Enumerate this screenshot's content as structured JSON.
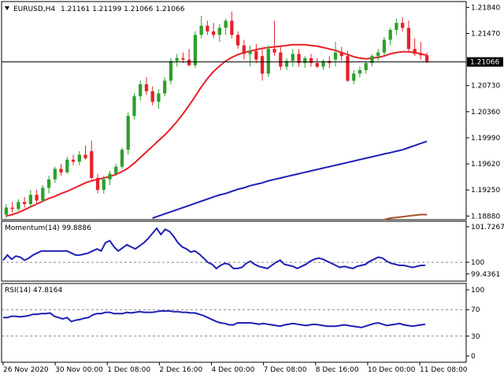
{
  "header": {
    "symbol": "EURUSD,H4",
    "ohlc": "1.21161 1.21199 1.21066 1.21066"
  },
  "colors": {
    "bull": "#2ca02c",
    "bear": "#e8202a",
    "sma_short": "#e8202a",
    "sma_long": "#1f1fb4",
    "sma_longest": "#a0522d",
    "indicator": "#1f1fb4"
  },
  "chart_data": [
    {
      "type": "candlestick",
      "title": "EURUSD,H4",
      "y_ticks": [
        "1.21840",
        "1.21470",
        "1.21066",
        "1.20730",
        "1.20360",
        "1.19990",
        "1.19620",
        "1.19250",
        "1.18880"
      ],
      "ylim": [
        1.1885,
        1.219
      ],
      "current_price": 1.21066,
      "x_ticks": [
        "26 Nov 2020",
        "30 Nov 00:00",
        "1 Dec 08:00",
        "2 Dec 16:00",
        "4 Dec 00:00",
        "7 Dec 08:00",
        "8 Dec 16:00",
        "10 Dec 00:00",
        "11 Dec 08:00"
      ],
      "candles": [
        [
          1.189,
          1.1905,
          1.1885,
          1.19
        ],
        [
          1.19,
          1.1908,
          1.1893,
          1.1898
        ],
        [
          1.1898,
          1.1912,
          1.1895,
          1.1908
        ],
        [
          1.1908,
          1.1915,
          1.19,
          1.1905
        ],
        [
          1.1905,
          1.1925,
          1.19,
          1.1918
        ],
        [
          1.1918,
          1.1925,
          1.1905,
          1.191
        ],
        [
          1.191,
          1.1932,
          1.1908,
          1.1928
        ],
        [
          1.1928,
          1.1945,
          1.192,
          1.194
        ],
        [
          1.194,
          1.1958,
          1.1935,
          1.1955
        ],
        [
          1.1955,
          1.1962,
          1.1945,
          1.195
        ],
        [
          1.195,
          1.1972,
          1.1948,
          1.1968
        ],
        [
          1.1968,
          1.1975,
          1.196,
          1.1965
        ],
        [
          1.1965,
          1.198,
          1.196,
          1.1975
        ],
        [
          1.1975,
          1.1988,
          1.1968,
          1.197
        ],
        [
          1.198,
          1.1995,
          1.194,
          1.1942
        ],
        [
          1.1942,
          1.1948,
          1.192,
          1.1925
        ],
        [
          1.1925,
          1.1945,
          1.192,
          1.194
        ],
        [
          1.194,
          1.1952,
          1.1932,
          1.1948
        ],
        [
          1.1948,
          1.1962,
          1.1945,
          1.1958
        ],
        [
          1.1958,
          1.1985,
          1.1955,
          1.1982
        ],
        [
          1.1982,
          1.2035,
          1.1975,
          1.203
        ],
        [
          1.203,
          1.2062,
          1.2025,
          1.2058
        ],
        [
          1.2058,
          1.208,
          1.2052,
          1.2075
        ],
        [
          1.2075,
          1.2085,
          1.206,
          1.2065
        ],
        [
          1.2065,
          1.2072,
          1.2045,
          1.205
        ],
        [
          1.205,
          1.2068,
          1.204,
          1.2062
        ],
        [
          1.2062,
          1.2085,
          1.2058,
          1.208
        ],
        [
          1.208,
          1.2112,
          1.2075,
          1.2108
        ],
        [
          1.2108,
          1.2118,
          1.21,
          1.2112
        ],
        [
          1.2112,
          1.212,
          1.2105,
          1.211
        ],
        [
          1.211,
          1.2125,
          1.21,
          1.2102
        ],
        [
          1.2102,
          1.215,
          1.2098,
          1.2145
        ],
        [
          1.2145,
          1.2172,
          1.214,
          1.2158
        ],
        [
          1.2158,
          1.2165,
          1.2145,
          1.215
        ],
        [
          1.215,
          1.2162,
          1.214,
          1.2145
        ],
        [
          1.2145,
          1.216,
          1.2135,
          1.2155
        ],
        [
          1.2155,
          1.2168,
          1.2145,
          1.2165
        ],
        [
          1.2165,
          1.2178,
          1.214,
          1.2145
        ],
        [
          1.2145,
          1.215,
          1.2125,
          1.213
        ],
        [
          1.213,
          1.2138,
          1.211,
          1.2118
        ],
        [
          1.2118,
          1.213,
          1.21,
          1.2122
        ],
        [
          1.2122,
          1.2132,
          1.2105,
          1.211
        ],
        [
          1.2115,
          1.2125,
          1.208,
          1.209
        ],
        [
          1.209,
          1.213,
          1.2085,
          1.2125
        ],
        [
          1.2125,
          1.2165,
          1.2115,
          1.212
        ],
        [
          1.212,
          1.2128,
          1.2095,
          1.21
        ],
        [
          1.21,
          1.2112,
          1.2095,
          1.2108
        ],
        [
          1.2108,
          1.2125,
          1.21,
          1.2118
        ],
        [
          1.2118,
          1.2125,
          1.21,
          1.2105
        ],
        [
          1.2105,
          1.2115,
          1.2098,
          1.2112
        ],
        [
          1.2112,
          1.2118,
          1.21,
          1.2105
        ],
        [
          1.2105,
          1.2112,
          1.2098,
          1.21
        ],
        [
          1.21,
          1.211,
          1.2095,
          1.2108
        ],
        [
          1.2108,
          1.2115,
          1.2098,
          1.2105
        ],
        [
          1.211,
          1.2135,
          1.21,
          1.212
        ],
        [
          1.212,
          1.2128,
          1.2108,
          1.2115
        ],
        [
          1.2115,
          1.2122,
          1.2078,
          1.208
        ],
        [
          1.208,
          1.2095,
          1.2075,
          1.209
        ],
        [
          1.209,
          1.21,
          1.2085,
          1.2095
        ],
        [
          1.2095,
          1.2108,
          1.209,
          1.2105
        ],
        [
          1.2105,
          1.2118,
          1.21,
          1.2115
        ],
        [
          1.2115,
          1.2125,
          1.2108,
          1.212
        ],
        [
          1.212,
          1.2142,
          1.2115,
          1.2138
        ],
        [
          1.2138,
          1.2155,
          1.213,
          1.2152
        ],
        [
          1.2152,
          1.2168,
          1.2145,
          1.2162
        ],
        [
          1.2162,
          1.217,
          1.215,
          1.2155
        ],
        [
          1.2155,
          1.2165,
          1.212,
          1.2125
        ],
        [
          1.2125,
          1.214,
          1.2115,
          1.2118
        ],
        [
          1.2118,
          1.2135,
          1.211,
          1.2116
        ],
        [
          1.2116,
          1.212,
          1.2105,
          1.2107
        ]
      ],
      "sma_short": [
        1.1888,
        1.189,
        1.1893,
        1.1897,
        1.1901,
        1.1905,
        1.1909,
        1.1913,
        1.1916,
        1.192,
        1.1923,
        1.1927,
        1.1931,
        1.1935,
        1.1938,
        1.194,
        1.1942,
        1.1944,
        1.1947,
        1.1951,
        1.1956,
        1.1963,
        1.1971,
        1.1979,
        1.1987,
        1.1995,
        1.2003,
        1.2012,
        1.2022,
        1.2033,
        1.2045,
        1.2058,
        1.2071,
        1.2083,
        1.2093,
        1.2101,
        1.2108,
        1.2113,
        1.2117,
        1.212,
        1.2122,
        1.2124,
        1.2126,
        1.2127,
        1.2128,
        1.2129,
        1.213,
        1.2131,
        1.2131,
        1.2131,
        1.213,
        1.2129,
        1.2127,
        1.2125,
        1.2123,
        1.212,
        1.2117,
        1.2114,
        1.2112,
        1.2111,
        1.2112,
        1.2113,
        1.2115,
        1.2118,
        1.212,
        1.2121,
        1.2121,
        1.212,
        1.2118,
        1.2116
      ],
      "sma_long": [
        null,
        null,
        null,
        null,
        null,
        null,
        null,
        null,
        null,
        null,
        null,
        null,
        null,
        null,
        null,
        null,
        null,
        null,
        null,
        null,
        null,
        null,
        null,
        null,
        1.1885,
        1.1888,
        1.1891,
        1.1894,
        1.1897,
        1.19,
        1.1903,
        1.1906,
        1.1909,
        1.1912,
        1.1915,
        1.1918,
        1.192,
        1.1923,
        1.1926,
        1.1928,
        1.1931,
        1.1933,
        1.1935,
        1.1938,
        1.194,
        1.1942,
        1.1944,
        1.1946,
        1.1948,
        1.195,
        1.1952,
        1.1954,
        1.1956,
        1.1958,
        1.196,
        1.1962,
        1.1964,
        1.1966,
        1.1968,
        1.197,
        1.1972,
        1.1974,
        1.1976,
        1.1978,
        1.198,
        1.1982,
        1.1985,
        1.1988,
        1.1991,
        1.1994
      ],
      "sma_longest": [
        null,
        null,
        null,
        null,
        null,
        null,
        null,
        null,
        null,
        null,
        null,
        null,
        null,
        null,
        null,
        null,
        null,
        null,
        null,
        null,
        null,
        null,
        null,
        null,
        null,
        null,
        null,
        null,
        null,
        null,
        null,
        null,
        null,
        null,
        null,
        null,
        null,
        null,
        null,
        null,
        null,
        null,
        null,
        null,
        null,
        null,
        null,
        null,
        null,
        null,
        null,
        null,
        null,
        null,
        null,
        null,
        null,
        null,
        null,
        null,
        null,
        null,
        1.1883,
        1.1885,
        1.1886,
        1.1887,
        1.1888,
        1.1889,
        1.189,
        1.189
      ]
    },
    {
      "type": "line",
      "title": "Momentum(14) 99.8886",
      "y_ticks": [
        "101.7267",
        "100",
        "99.4361"
      ],
      "ylim": [
        99.2,
        101.8
      ],
      "reference_level": 100,
      "series": [
        {
          "values": [
            100.1,
            100.35,
            100.15,
            100.3,
            100.25,
            100.1,
            100.2,
            100.35,
            100.45,
            100.55,
            100.55,
            100.55,
            100.55,
            100.55,
            100.55,
            100.55,
            100.45,
            100.35,
            100.35,
            100.4,
            100.45,
            100.55,
            100.65,
            100.55,
            100.95,
            101.05,
            100.75,
            100.55,
            100.7,
            100.85,
            100.75,
            100.65,
            100.8,
            100.95,
            101.15,
            101.4,
            101.65,
            101.35,
            101.6,
            101.5,
            101.25,
            100.95,
            100.75,
            100.65,
            100.5,
            100.55,
            100.4,
            100.2,
            100.0,
            99.9,
            99.7,
            99.85,
            99.95,
            99.9,
            99.7,
            99.7,
            99.75,
            99.95,
            100.05,
            99.9,
            99.8,
            99.75,
            99.7,
            99.85,
            100.0,
            100.1,
            99.9,
            99.85,
            99.8,
            99.7,
            99.8,
            99.9,
            100.05,
            100.15,
            100.2,
            100.15,
            100.05,
            99.95,
            99.85,
            99.75,
            99.8,
            99.75,
            99.7,
            99.8,
            99.85,
            99.9,
            100.05,
            100.15,
            100.25,
            100.2,
            100.05,
            99.95,
            99.9,
            99.85,
            99.85,
            99.8,
            99.75,
            99.8,
            99.85,
            99.85
          ]
        }
      ]
    },
    {
      "type": "line",
      "title": "RSI(14) 47.8164",
      "y_ticks": [
        "100",
        "70",
        "30",
        "0"
      ],
      "ylim": [
        0,
        100
      ],
      "reference_levels": [
        70,
        30
      ],
      "series": [
        {
          "values": [
            58,
            58,
            60,
            60,
            59,
            60,
            61,
            63,
            63,
            64,
            64,
            65,
            60,
            58,
            56,
            58,
            52,
            54,
            55,
            57,
            58,
            62,
            64,
            64,
            66,
            66,
            64,
            64,
            64,
            66,
            65,
            66,
            67,
            66,
            66,
            66,
            67,
            68,
            68,
            68,
            67,
            67,
            66,
            66,
            65,
            65,
            63,
            61,
            58,
            55,
            52,
            50,
            49,
            47,
            47,
            50,
            50,
            50,
            50,
            49,
            48,
            49,
            48,
            47,
            46,
            45,
            47,
            48,
            49,
            48,
            47,
            46,
            47,
            48,
            47,
            46,
            45,
            45,
            45,
            46,
            47,
            46,
            45,
            44,
            43,
            45,
            47,
            49,
            50,
            48,
            46,
            47,
            48,
            49,
            47,
            46,
            45,
            46,
            47,
            48
          ]
        }
      ]
    }
  ]
}
